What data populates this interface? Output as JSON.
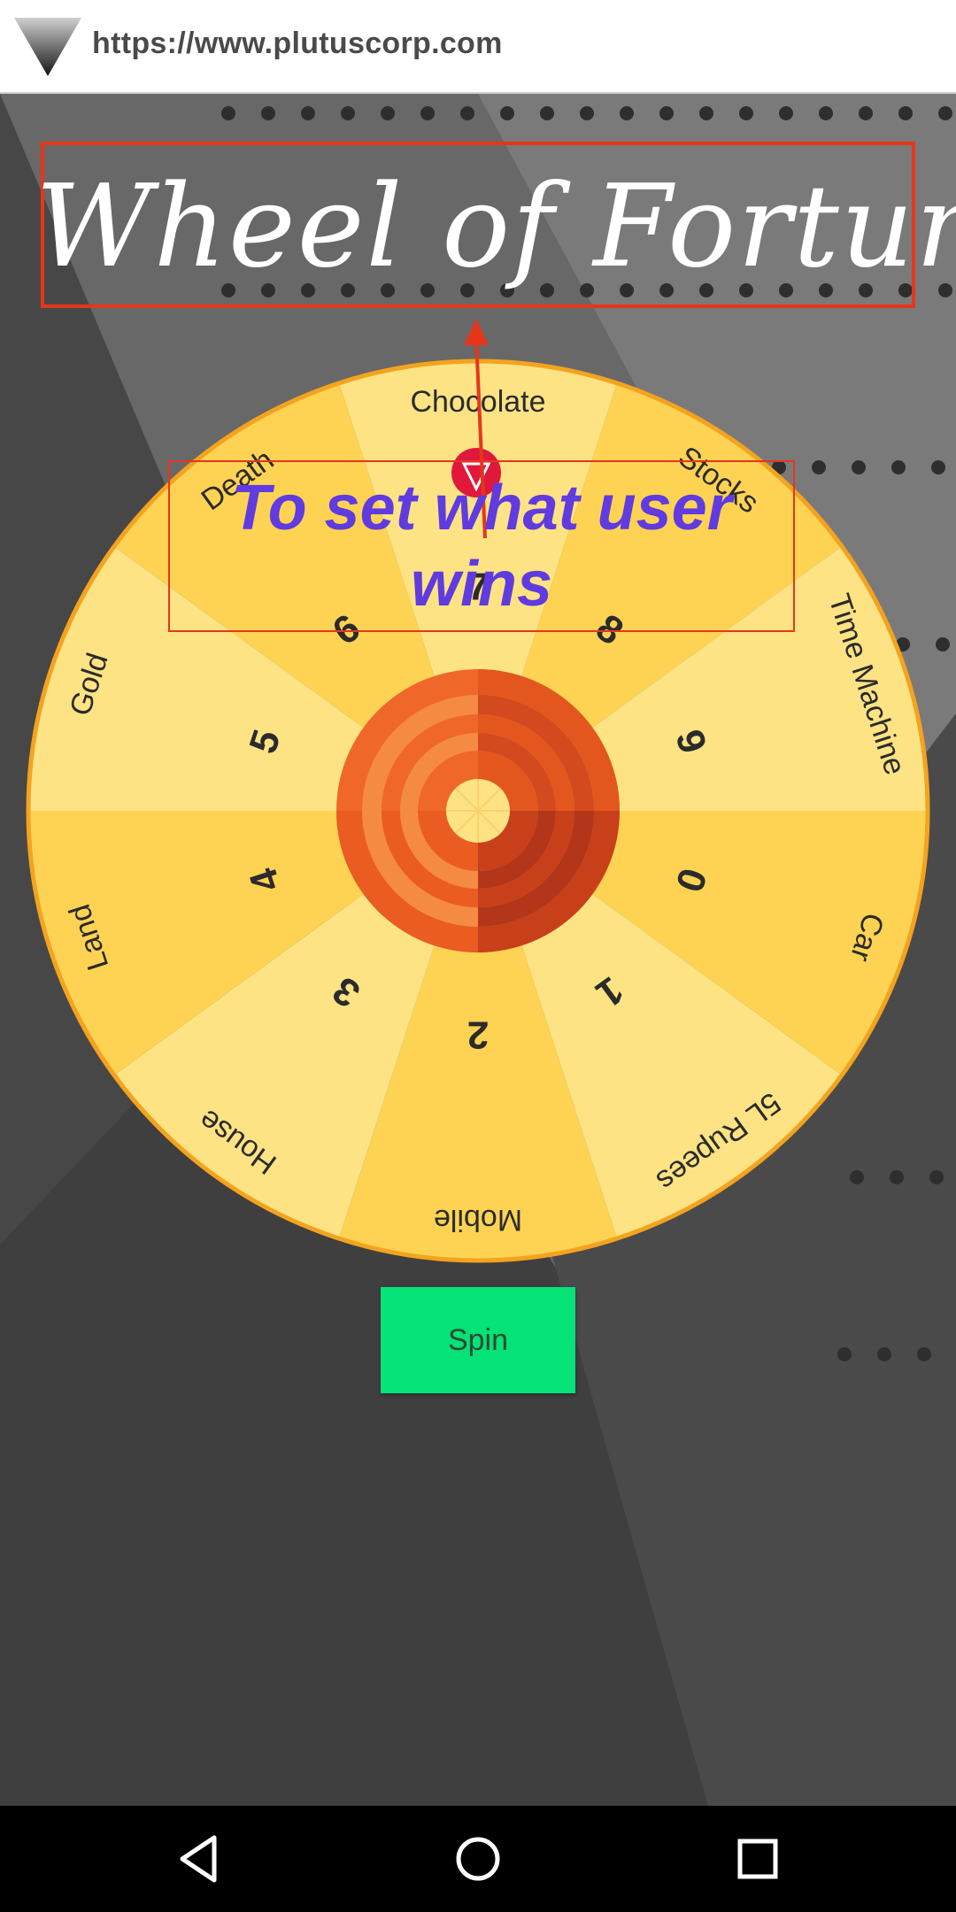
{
  "browser": {
    "url": "https://www.plutuscorp.com"
  },
  "page": {
    "title": "Wheel of Fortune",
    "annotation": "To set what user wins",
    "spin_label": "Spin"
  },
  "wheel": {
    "pointer_icon": "pointer-icon",
    "segments": [
      {
        "label": "Chocolate",
        "number": "7"
      },
      {
        "label": "Stocks",
        "number": "8"
      },
      {
        "label": "Time Machine",
        "number": "9"
      },
      {
        "label": "Car",
        "number": "0"
      },
      {
        "label": "5L Rupees",
        "number": "1"
      },
      {
        "label": "Mobile",
        "number": "2"
      },
      {
        "label": "House",
        "number": "3"
      },
      {
        "label": "Land",
        "number": "4"
      },
      {
        "label": "Gold",
        "number": "5"
      },
      {
        "label": "Death",
        "number": "6"
      }
    ],
    "colors": {
      "light": "#fde384",
      "dark": "#fed353",
      "rim": "#f4a31f",
      "hub": "#f0672a",
      "annotation": "#e5361c",
      "annotation_text": "#5f3be0",
      "spin_button": "#05e277"
    }
  },
  "navbar": {
    "icons": [
      "back-icon",
      "home-icon",
      "recents-icon"
    ]
  }
}
